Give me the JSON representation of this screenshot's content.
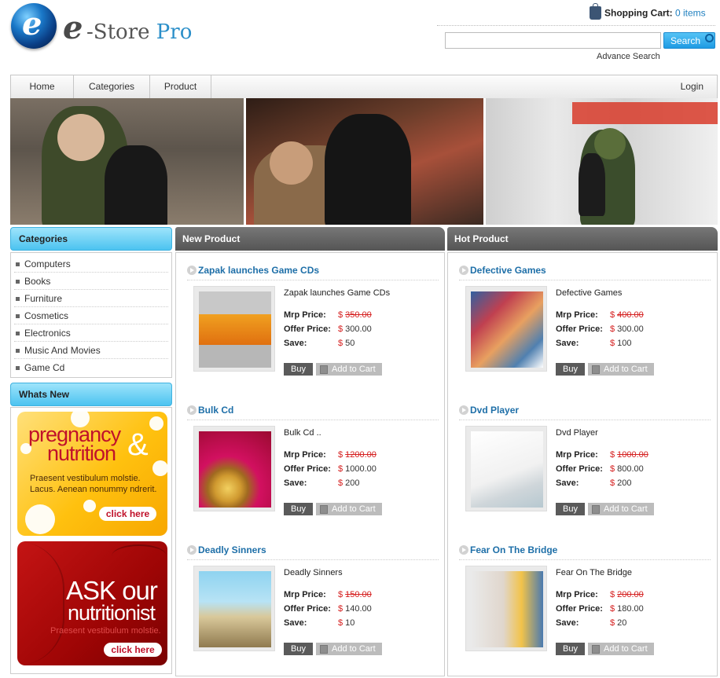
{
  "header": {
    "logo_letter": "e",
    "logo_store": "-Store",
    "logo_pro": "Pro",
    "cart_label": "Shopping Cart:",
    "cart_count": "0 items",
    "search_placeholder": "",
    "search_button": "Search",
    "advance_search": "Advance Search"
  },
  "nav": {
    "items": [
      {
        "label": "Home"
      },
      {
        "label": "Categories"
      },
      {
        "label": "Product"
      }
    ],
    "login": "Login"
  },
  "sidebar": {
    "categories_title": "Categories",
    "categories": [
      {
        "label": "Computers"
      },
      {
        "label": "Books"
      },
      {
        "label": "Furniture"
      },
      {
        "label": "Cosmetics"
      },
      {
        "label": "Electronics"
      },
      {
        "label": "Music And Movies"
      },
      {
        "label": "Game Cd"
      }
    ],
    "whats_new_title": "Whats New",
    "ad1": {
      "headline_a": "pregnancy",
      "amp": "&",
      "headline_b": "nutrition",
      "body_1": "Praesent vestibulum molstie.",
      "body_2": "Lacus. Aenean nonummy ndrerit.",
      "button": "click here"
    },
    "ad2": {
      "headline_a": "ASK our",
      "headline_b": "nutritionist",
      "body": "Praesent vestibulum molstie.",
      "button": "click here"
    }
  },
  "new_product": {
    "title": "New Product",
    "items": [
      {
        "title": "Zapak launches Game CDs",
        "name": "Zapak launches Game CDs",
        "mrp_label": "Mrp Price:",
        "mrp": "350.00",
        "offer_label": "Offer Price:",
        "offer": "300.00",
        "save_label": "Save:",
        "save": "50",
        "currency": "$",
        "buy": "Buy",
        "add": "Add to Cart"
      },
      {
        "title": "Bulk Cd",
        "name": "Bulk Cd ..",
        "mrp_label": "Mrp Price:",
        "mrp": "1200.00",
        "offer_label": "Offer Price:",
        "offer": "1000.00",
        "save_label": "Save:",
        "save": "200",
        "currency": "$",
        "buy": "Buy",
        "add": "Add to Cart"
      },
      {
        "title": "Deadly Sinners",
        "name": "Deadly Sinners",
        "mrp_label": "Mrp Price:",
        "mrp": "150.00",
        "offer_label": "Offer Price:",
        "offer": "140.00",
        "save_label": "Save:",
        "save": "10",
        "currency": "$",
        "buy": "Buy",
        "add": "Add to Cart"
      }
    ]
  },
  "hot_product": {
    "title": "Hot Product",
    "items": [
      {
        "title": "Defective Games",
        "name": "Defective Games",
        "mrp_label": "Mrp Price:",
        "mrp": "400.00",
        "offer_label": "Offer Price:",
        "offer": "300.00",
        "save_label": "Save:",
        "save": "100",
        "currency": "$",
        "buy": "Buy",
        "add": "Add to Cart"
      },
      {
        "title": "Dvd Player",
        "name": "Dvd Player",
        "mrp_label": "Mrp Price:",
        "mrp": "1000.00",
        "offer_label": "Offer Price:",
        "offer": "800.00",
        "save_label": "Save:",
        "save": "200",
        "currency": "$",
        "buy": "Buy",
        "add": "Add to Cart"
      },
      {
        "title": "Fear On The Bridge",
        "name": "Fear On The Bridge",
        "mrp_label": "Mrp Price:",
        "mrp": "200.00",
        "offer_label": "Offer Price:",
        "offer": "180.00",
        "save_label": "Save:",
        "save": "20",
        "currency": "$",
        "buy": "Buy",
        "add": "Add to Cart"
      }
    ]
  },
  "colors": {
    "accent_blue": "#1e6fa8",
    "price_red": "#d51f1f",
    "sidebar_head": "#4cc3f0",
    "column_head": "#555555"
  }
}
